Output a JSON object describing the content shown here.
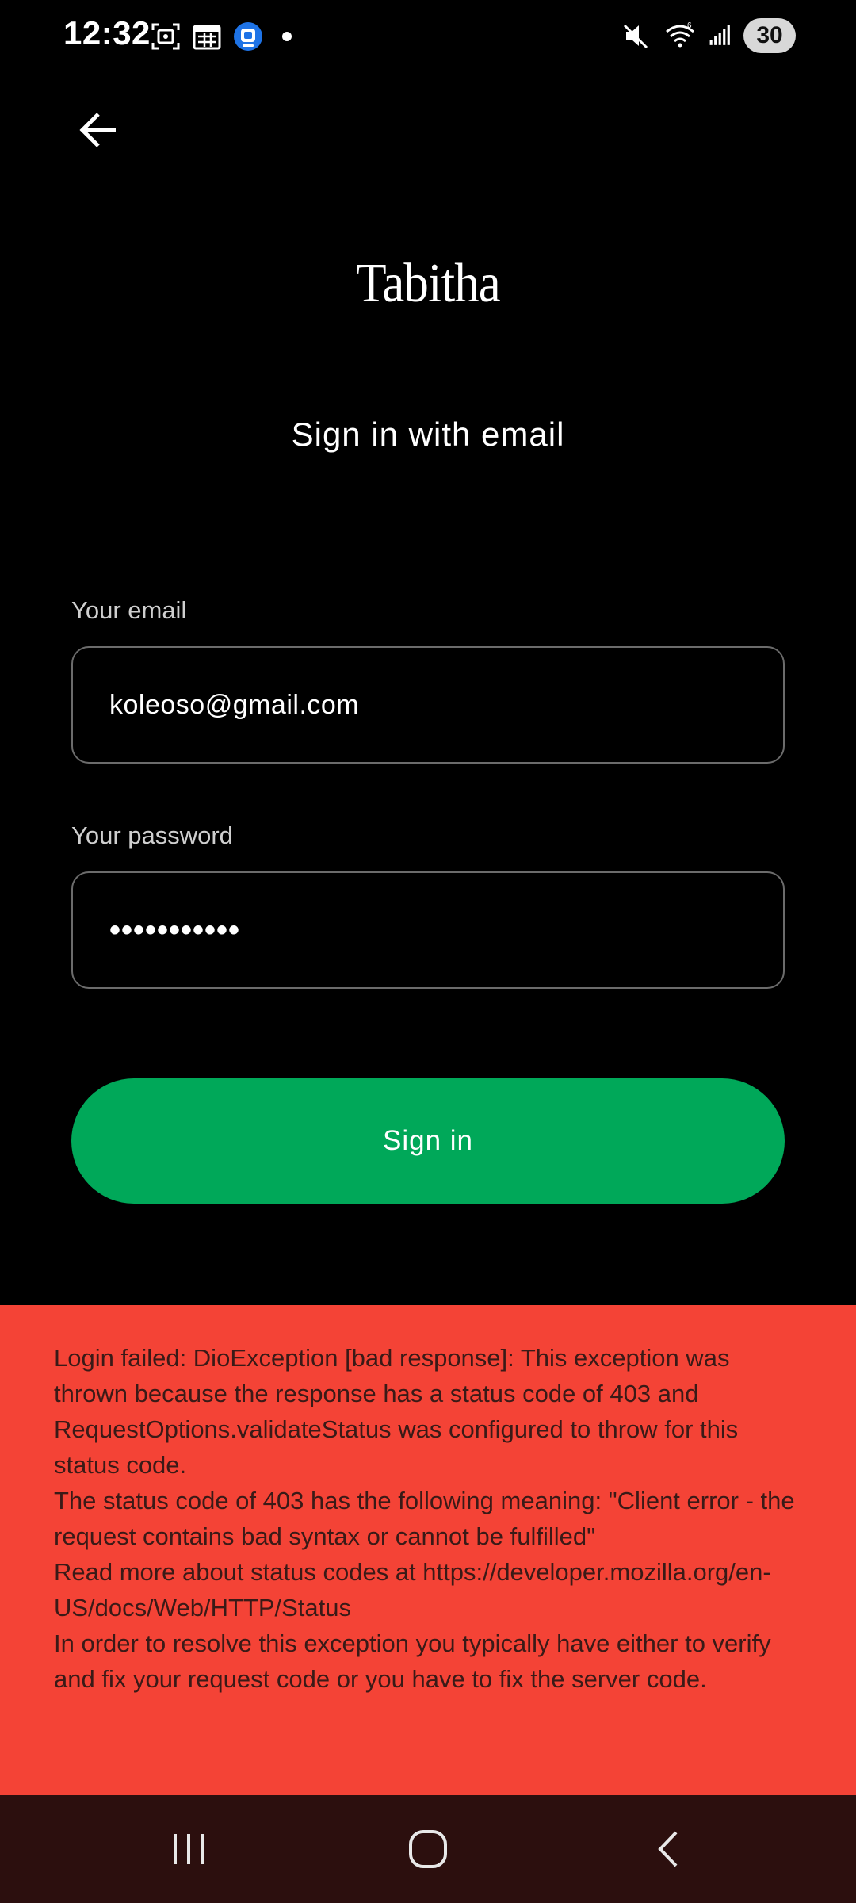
{
  "status_bar": {
    "time": "12:32",
    "battery": "30",
    "left_icons": [
      "screenshot-icon",
      "calendar-icon",
      "app-notification-icon",
      "dot-icon"
    ],
    "right_icons": [
      "mute-icon",
      "wifi-icon",
      "signal-icon",
      "battery-icon"
    ]
  },
  "header": {
    "back_icon": "arrow-left-icon",
    "brand": "Tabitha",
    "subtitle": "Sign in with email"
  },
  "form": {
    "email_label": "Your email",
    "email_value": "koleoso@gmail.com",
    "password_label": "Your password",
    "password_value": "•••••••••••",
    "submit_label": "Sign in"
  },
  "error": {
    "message": "Login failed: DioException [bad response]: This exception was thrown because the response has a status code of 403 and RequestOptions.validateStatus was configured to throw for this status code.\nThe status code of 403 has the following meaning: \"Client error - the request contains bad syntax or cannot be fulfilled\"\nRead more about status codes at https://developer.mozilla.org/en-US/docs/Web/HTTP/Status\nIn order to resolve this exception you typically have either to verify and fix your request code or you have to fix the server code."
  },
  "nav_bar": {
    "icons": [
      "recent-apps-icon",
      "home-icon",
      "back-icon"
    ]
  },
  "colors": {
    "background": "#000000",
    "accent_green": "#00a859",
    "error_red": "#f44336",
    "nav_bar": "#2c0f0e",
    "field_border": "#6b6b6b"
  }
}
